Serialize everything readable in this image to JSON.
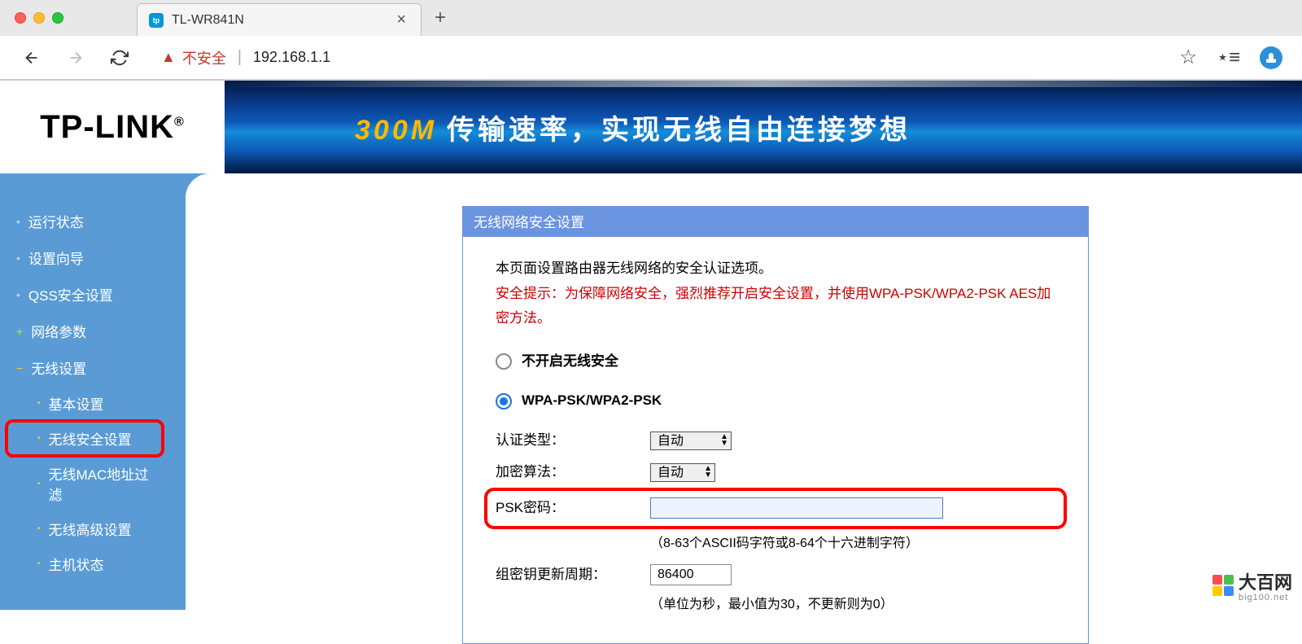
{
  "browser": {
    "tab_title": "TL-WR841N",
    "tab_favicon_text": "tp",
    "security_label": "不安全",
    "url": "192.168.1.1"
  },
  "header": {
    "logo": "TP-LINK",
    "logo_reg": "®",
    "banner_300m": "300M",
    "banner_text": "传输速率，实现无线自由连接梦想"
  },
  "sidebar": {
    "items": [
      {
        "label": "运行状态",
        "type": "simple"
      },
      {
        "label": "设置向导",
        "type": "simple"
      },
      {
        "label": "QSS安全设置",
        "type": "simple"
      },
      {
        "label": "网络参数",
        "type": "expandable"
      },
      {
        "label": "无线设置",
        "type": "expanded"
      }
    ],
    "subitems": [
      {
        "label": "基本设置"
      },
      {
        "label": "无线安全设置",
        "highlighted": true
      },
      {
        "label": "无线MAC地址过滤"
      },
      {
        "label": "无线高级设置"
      },
      {
        "label": "主机状态"
      }
    ]
  },
  "content": {
    "box_title": "无线网络安全设置",
    "desc1": "本页面设置路由器无线网络的安全认证选项。",
    "desc2": "安全提示：为保障网络安全，强烈推荐开启安全设置，并使用WPA-PSK/WPA2-PSK AES加密方法。",
    "radio_off": "不开启无线安全",
    "radio_wpa": "WPA-PSK/WPA2-PSK",
    "auth_type_label": "认证类型：",
    "auth_type_value": "自动",
    "encrypt_label": "加密算法：",
    "encrypt_value": "自动",
    "psk_label": "PSK密码：",
    "psk_value": "",
    "psk_hint": "（8-63个ASCII码字符或8-64个十六进制字符）",
    "group_key_label": "组密钥更新周期：",
    "group_key_value": "86400",
    "group_key_hint": "（单位为秒，最小值为30，不更新则为0）"
  },
  "watermark": {
    "text": "大百网",
    "sub": "big100.net"
  }
}
